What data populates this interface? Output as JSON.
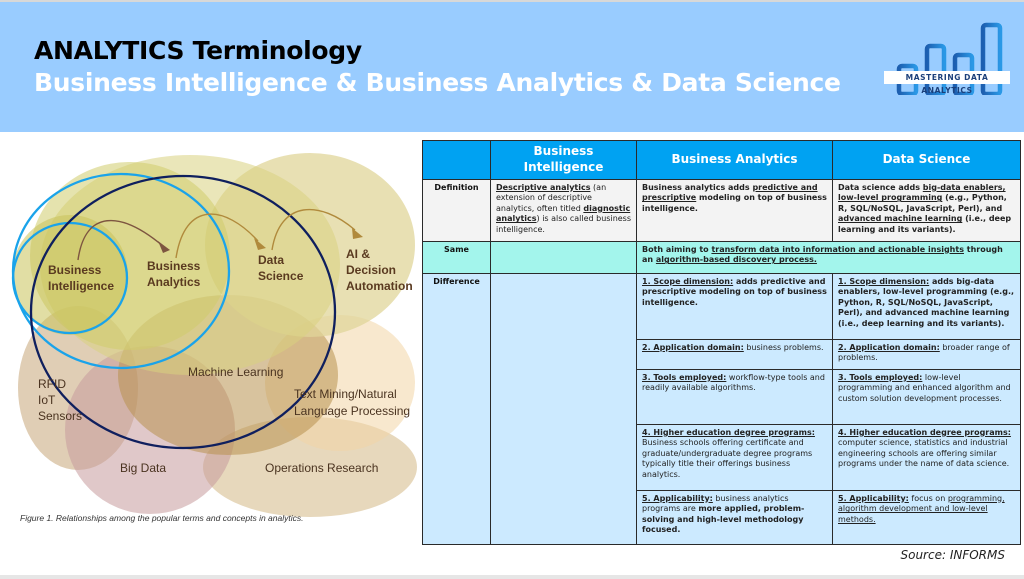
{
  "header": {
    "title": "ANALYTICS Terminology",
    "subtitle": "Business Intelligence & Business Analytics & Data Science",
    "logo_text": "MASTERING DATA ANALYTICS",
    "banner_color": "#99CCFF",
    "logo_color": "#1F6FC4"
  },
  "diagram": {
    "labels": {
      "business_intelligence": [
        "Business",
        "Intelligence"
      ],
      "business_analytics": [
        "Business",
        "Analytics"
      ],
      "data_science": [
        "Data",
        "Science"
      ],
      "ai_decision": [
        "AI &",
        "Decision",
        "Automation"
      ],
      "machine_learning": "Machine Learning",
      "rfid": [
        "RFID",
        "IoT",
        "Sensors"
      ],
      "text_mining": [
        "Text Mining/Natural",
        "Language Processing"
      ],
      "big_data": "Big Data",
      "operations_research": "Operations Research"
    },
    "caption": "Figure 1. Relationships among the popular terms and concepts in analytics."
  },
  "table": {
    "columns": [
      "",
      "Business Intelligence",
      "Business Analytics",
      "Data Science"
    ],
    "header_color": "#00A2F2",
    "rows": {
      "definition": {
        "label": "Definition",
        "bi": {
          "p1": "Descriptive analytics",
          "p2": " (an extension of descriptive analytics, often titled ",
          "p3": "diagnostic analytics",
          "p4": ") is also called business intelligence."
        },
        "ba": {
          "p1": "Business analytics adds ",
          "p2": "predictive and prescriptive",
          "p3": " modeling on top of business intelligence."
        },
        "ds": {
          "p1": "Data science adds ",
          "p2": "big-data enablers,",
          "p3": " ",
          "p4": "low-level programming",
          "p5": " (e.g., Python, R, SQL/NoSQL, JavaScript, Perl), and ",
          "p6": "advanced machine learning",
          "p7": " (i.e., deep learning and its variants)."
        }
      },
      "same": {
        "label": "Same",
        "p1": "Both aiming to ",
        "p2": "transform data into information and actionable insights",
        "p3": " through an ",
        "p4": "algorithm-based discovery process."
      },
      "difference": {
        "label": "Difference",
        "items": [
          {
            "ba_head": "1. Scope dimension:",
            "ba_text": " adds predictive and prescriptive modeling on top of business intelligence.",
            "ds_head": "1. Scope dimension:",
            "ds_text": " adds big-data enablers, low-level programming (e.g., Python, R, SQL/NoSQL, JavaScript, Perl), and advanced machine learning (i.e., deep learning and its variants)."
          },
          {
            "ba_head": "2. Application domain:",
            "ba_text": " business problems.",
            "ds_head": "2. Application domain:",
            "ds_text": " broader range of problems."
          },
          {
            "ba_head": "3. Tools employed:",
            "ba_text": " workflow-type tools and readily available algorithms.",
            "ds_head": "3. Tools employed:",
            "ds_text": " low-level programming and enhanced algorithm and custom solution development processes."
          },
          {
            "ba_head": "4. Higher education degree programs:",
            "ba_text": " Business schools offering certificate and graduate/undergraduate degree programs typically title their offerings business analytics.",
            "ds_head": "4. Higher education degree programs:",
            "ds_text": " computer science, statistics and industrial engineering schools are offering similar programs under the name of data science."
          },
          {
            "ba_head": "5. Applicability:",
            "ba_text": " business analytics programs are ",
            "ba_bold": "more applied, problem-solving and high-level methodology focused.",
            "ds_head": "5. Applicability:",
            "ds_text": " focus on ",
            "ds_under": "programming, algorithm development and low-level methods."
          }
        ]
      }
    }
  },
  "source": "Source: INFORMS"
}
